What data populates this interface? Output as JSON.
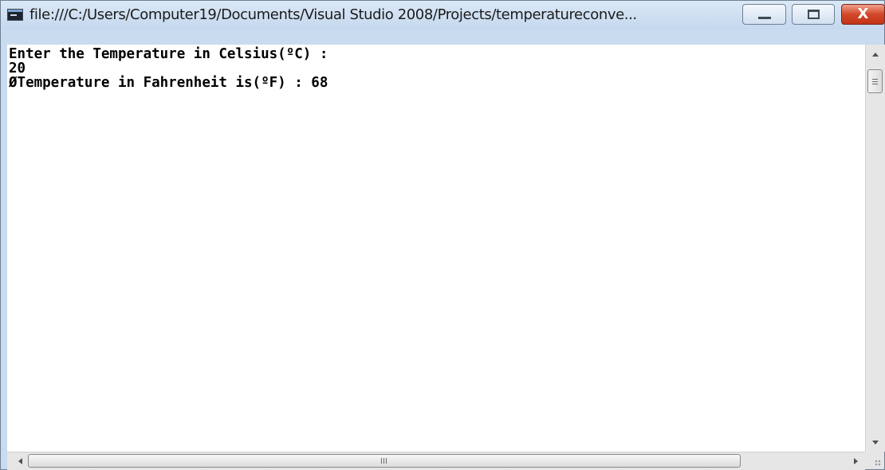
{
  "window": {
    "title": "file:///C:/Users/Computer19/Documents/Visual Studio 2008/Projects/temperatureconve...",
    "controls": {
      "minimize": "minimize",
      "maximize": "maximize",
      "close": "X"
    }
  },
  "console": {
    "lines": [
      "Enter the Temperature in Celsius(ºC) :",
      "20",
      "ØTemperature in Fahrenheit is(ºF) : 68"
    ]
  },
  "colors": {
    "titlebar": "#c9dbef",
    "close_button": "#c9452a",
    "console_background": "#ffffff",
    "console_text": "#000000"
  }
}
